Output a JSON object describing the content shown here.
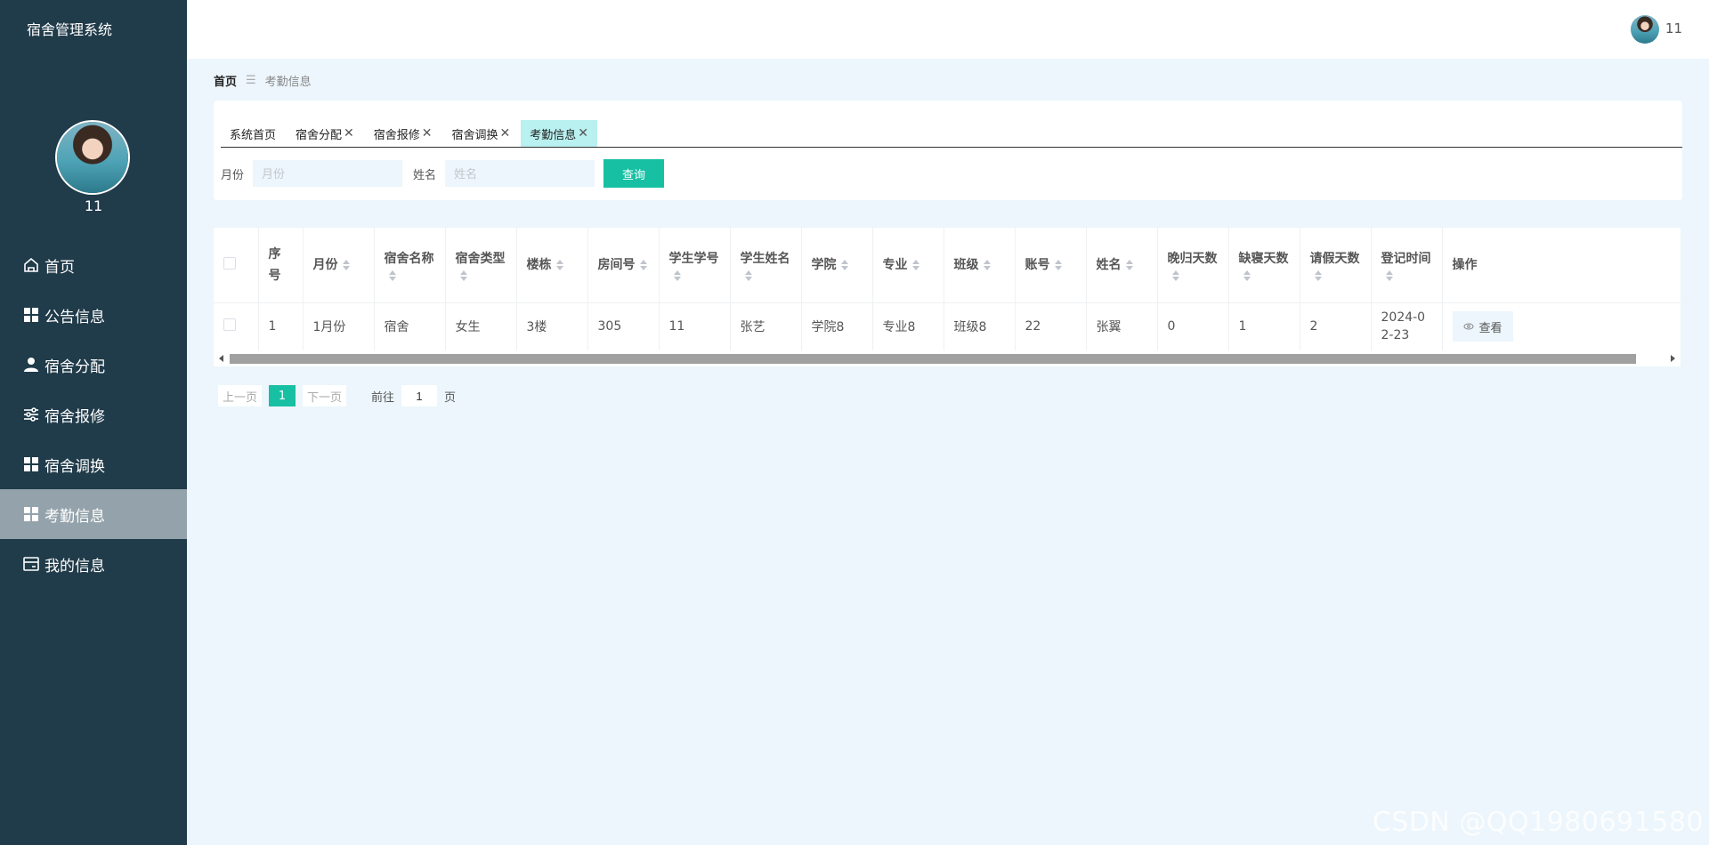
{
  "app": {
    "title": "宿舍管理系统"
  },
  "profile": {
    "name": "11"
  },
  "menu": [
    {
      "label": "首页",
      "icon": "home-icon"
    },
    {
      "label": "公告信息",
      "icon": "grid-icon"
    },
    {
      "label": "宿舍分配",
      "icon": "user-icon"
    },
    {
      "label": "宿舍报修",
      "icon": "sliders-icon"
    },
    {
      "label": "宿舍调换",
      "icon": "grid-icon"
    },
    {
      "label": "考勤信息",
      "icon": "grid-icon",
      "active": true
    },
    {
      "label": "我的信息",
      "icon": "card-icon"
    }
  ],
  "header": {
    "user": "11"
  },
  "breadcrumb": {
    "home": "首页",
    "separator": "☰",
    "current": "考勤信息"
  },
  "tabs": [
    {
      "label": "系统首页",
      "closable": false
    },
    {
      "label": "宿舍分配",
      "closable": true
    },
    {
      "label": "宿舍报修",
      "closable": true
    },
    {
      "label": "宿舍调换",
      "closable": true
    },
    {
      "label": "考勤信息",
      "closable": true,
      "active": true
    }
  ],
  "search": {
    "month_label": "月份",
    "month_placeholder": "月份",
    "name_label": "姓名",
    "name_placeholder": "姓名",
    "button": "查询"
  },
  "table": {
    "columns": [
      {
        "label": "序号",
        "sortable": false
      },
      {
        "label": "月份",
        "sortable": true
      },
      {
        "label": "宿舍名称",
        "sortable": true
      },
      {
        "label": "宿舍类型",
        "sortable": true
      },
      {
        "label": "楼栋",
        "sortable": true
      },
      {
        "label": "房间号",
        "sortable": true
      },
      {
        "label": "学生学号",
        "sortable": true
      },
      {
        "label": "学生姓名",
        "sortable": true
      },
      {
        "label": "学院",
        "sortable": true
      },
      {
        "label": "专业",
        "sortable": true
      },
      {
        "label": "班级",
        "sortable": true
      },
      {
        "label": "账号",
        "sortable": true
      },
      {
        "label": "姓名",
        "sortable": true
      },
      {
        "label": "晚归天数",
        "sortable": true
      },
      {
        "label": "缺寝天数",
        "sortable": true
      },
      {
        "label": "请假天数",
        "sortable": true
      },
      {
        "label": "登记时间",
        "sortable": true
      },
      {
        "label": "操作",
        "sortable": false
      }
    ],
    "rows": [
      [
        "1",
        "1月份",
        "宿舍",
        "女生",
        "3楼",
        "305",
        "11",
        "张艺",
        "学院8",
        "专业8",
        "班级8",
        "22",
        "张翼",
        "0",
        "1",
        "2",
        "2024-02-23"
      ]
    ],
    "view_label": "查看"
  },
  "pagination": {
    "prev": "上一页",
    "current": "1",
    "next": "下一页",
    "goto_label": "前往",
    "goto_value": "1",
    "unit": "页"
  },
  "watermark": "CSDN @QQ1980691580"
}
